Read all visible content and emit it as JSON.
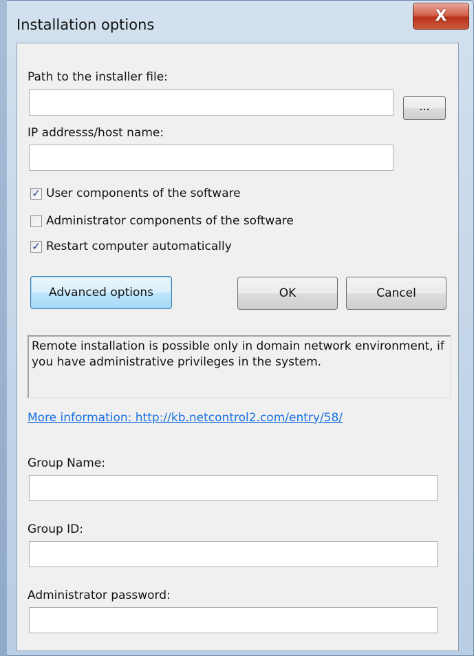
{
  "window": {
    "title": "Installation options",
    "close_glyph": "X"
  },
  "form": {
    "installer_path": {
      "label": "Path to the installer file:",
      "value": ""
    },
    "browse_label": "...",
    "host": {
      "label": "IP addresss/host name:",
      "value": ""
    },
    "checkboxes": [
      {
        "label": "User components of the software",
        "checked": true
      },
      {
        "label": "Administrator components of the software",
        "checked": false
      },
      {
        "label": "Restart computer automatically",
        "checked": true
      }
    ],
    "buttons": {
      "advanced": "Advanced options",
      "ok": "OK",
      "cancel": "Cancel"
    },
    "info_text": "Remote installation is possible only in domain network environment, if you have administrative privileges in the system.",
    "more_info_link": "More information: http://kb.netcontrol2.com/entry/58/",
    "group_name": {
      "label": "Group Name:",
      "value": ""
    },
    "group_id": {
      "label": "Group ID:",
      "value": ""
    },
    "admin_password": {
      "label": "Administrator password:",
      "value": ""
    }
  },
  "colors": {
    "link": "#1a6fe0",
    "dialog_bg": "#f0f0f0",
    "close_button": "#c9452b"
  }
}
